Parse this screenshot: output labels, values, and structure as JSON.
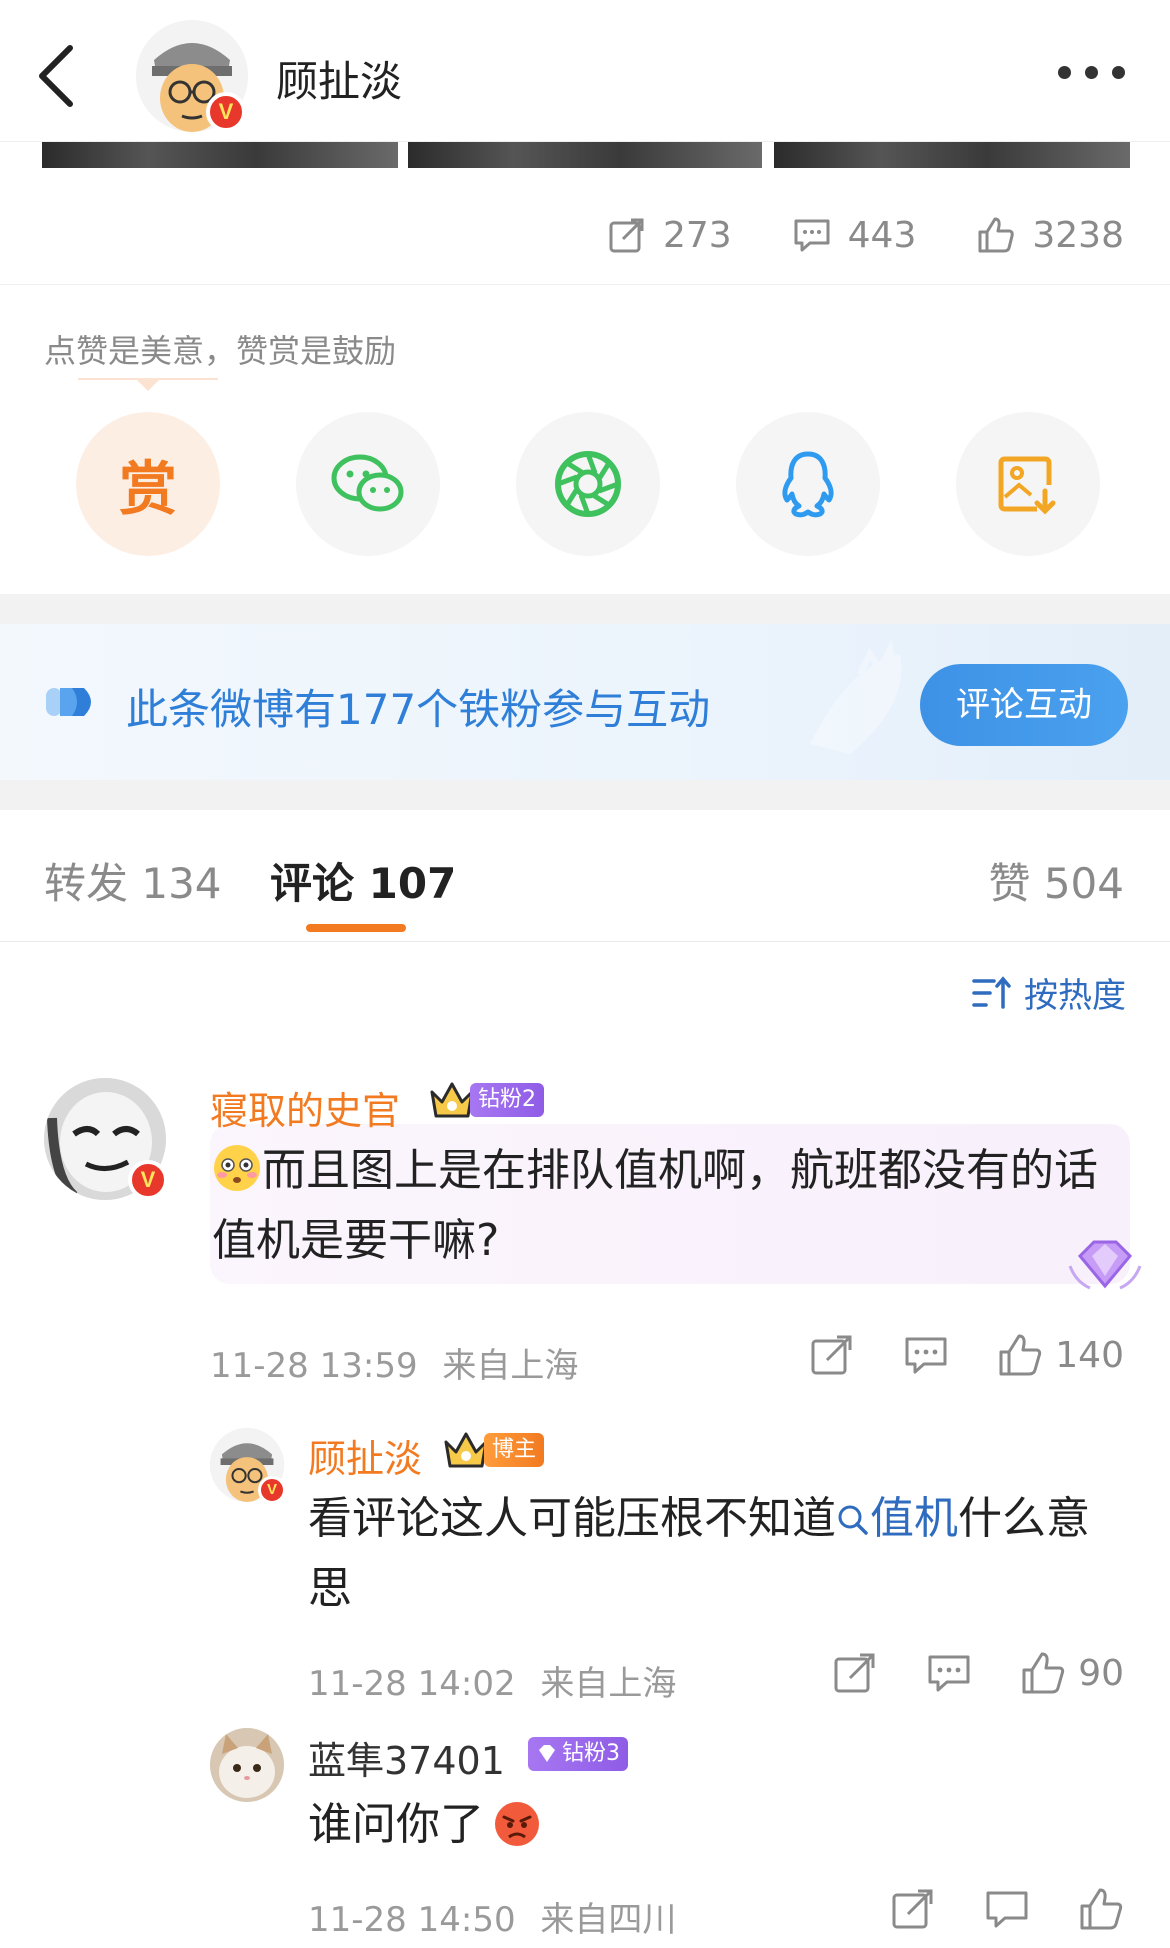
{
  "header": {
    "author_name": "顾扯淡",
    "verified_badge": "V"
  },
  "stats": {
    "reposts": "273",
    "comments": "443",
    "likes": "3238"
  },
  "reward": {
    "hint": "点赞是美意，赞赏是鼓励",
    "reward_label": "赏",
    "share_targets": [
      "reward",
      "wechat",
      "moments",
      "qq",
      "save-image"
    ]
  },
  "fans_banner": {
    "text": "此条微博有177个铁粉参与互动",
    "button": "评论互动"
  },
  "tabs": {
    "repost": "转发 134",
    "comment": "评论 107",
    "like": "赞 504"
  },
  "sort": {
    "label": "按热度"
  },
  "comments": [
    {
      "name": "寝取的史官",
      "badge": "钻粉2",
      "text": "而且图上是在排队值机啊，航班都没有的话值机是要干嘛?",
      "time": "11-28 13:59",
      "location": "来自上海",
      "likes": "140",
      "emoji": "flushed-face"
    },
    {
      "name": "顾扯淡",
      "badge": "博主",
      "text_before": "看评论这人可能压根不知道",
      "link": "值机",
      "text_after": "什么意思",
      "time": "11-28 14:02",
      "location": "来自上海",
      "likes": "90"
    },
    {
      "name": "蓝隼37401",
      "badge": "钻粉3",
      "text": "谁问你了",
      "time": "11-28 14:50",
      "location": "来自四川",
      "emoji": "angry-face"
    }
  ],
  "colors": {
    "accent_orange": "#f27a21",
    "link_blue": "#2f6cbf",
    "fans_blue": "#2f7fd8",
    "badge_purple": "#8f5ce6"
  }
}
